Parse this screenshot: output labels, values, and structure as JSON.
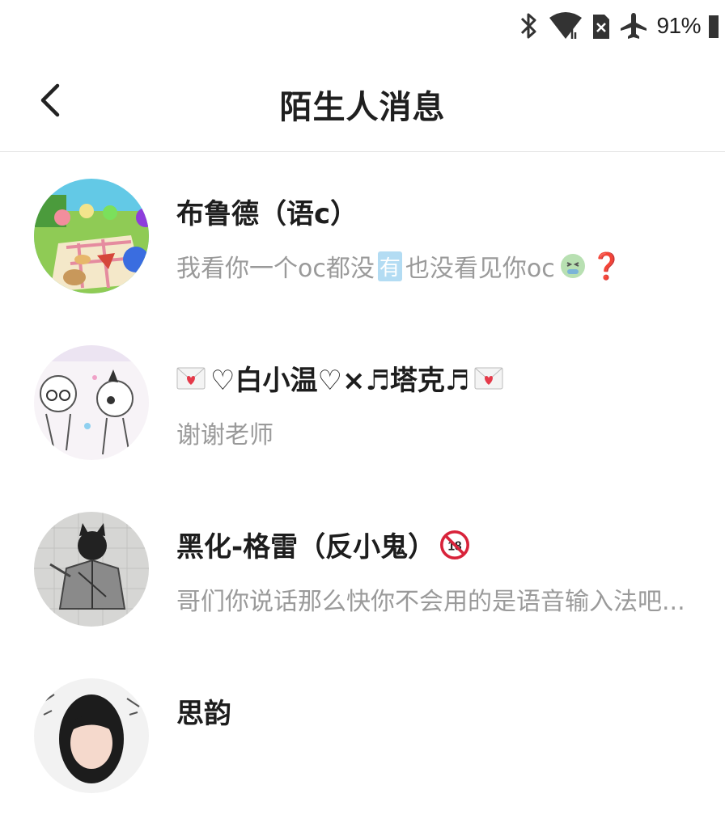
{
  "status": {
    "battery": "91%",
    "icons": [
      "bluetooth-icon",
      "wifi-icon",
      "no-sim-icon",
      "airplane-icon",
      "battery-icon"
    ]
  },
  "header": {
    "title": "陌生人消息",
    "back_icon": "chevron-left-icon"
  },
  "colors": {
    "title": "#1f1f1f",
    "preview": "#9a9a9a",
    "divider": "#e6e6e6"
  },
  "conversations": [
    {
      "name_prefix": "",
      "name": "布鲁德（语c）",
      "name_suffix": "",
      "preview_part1": "我看你一个oc都没",
      "preview_badge": "有",
      "preview_part2": "也没看见你oc",
      "preview_end_icons": [
        "sick-face-emoji",
        "question-mark-emoji"
      ],
      "avatar_icon": "cartoon-picnic-avatar"
    },
    {
      "name_prefix": "",
      "name": "♡白小温♡×♬塔克♬",
      "name_suffix": "",
      "name_icons": [
        "love-letter-emoji",
        "love-letter-emoji"
      ],
      "preview": "谢谢老师",
      "avatar_icon": "sketch-characters-avatar"
    },
    {
      "name": "黑化-格雷（反小鬼）",
      "name_icons": [
        "no-under-18-emoji"
      ],
      "preview": "哥们你说话那么快你不会用的是语音输入法吧...",
      "avatar_icon": "dark-cat-drawing-avatar"
    },
    {
      "name": "思韵",
      "preview": "",
      "avatar_icon": "girl-portrait-avatar"
    }
  ]
}
